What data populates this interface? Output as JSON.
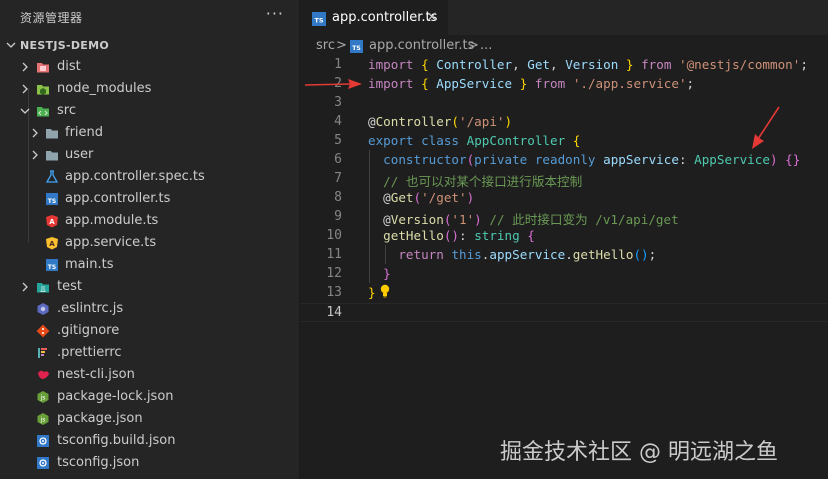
{
  "explorer": {
    "title": "资源管理器",
    "more_label": "···",
    "items": [
      {
        "label": "NESTJS-DEMO",
        "name": "tree-root-nestjs-demo"
      },
      {
        "label": "dist",
        "name": "tree-folder-dist"
      },
      {
        "label": "node_modules",
        "name": "tree-folder-node-modules"
      },
      {
        "label": "src",
        "name": "tree-folder-src"
      },
      {
        "label": "friend",
        "name": "tree-folder-friend"
      },
      {
        "label": "user",
        "name": "tree-folder-user"
      },
      {
        "label": "app.controller.spec.ts",
        "name": "tree-file-app-controller-spec"
      },
      {
        "label": "app.controller.ts",
        "name": "tree-file-app-controller"
      },
      {
        "label": "app.module.ts",
        "name": "tree-file-app-module"
      },
      {
        "label": "app.service.ts",
        "name": "tree-file-app-service"
      },
      {
        "label": "main.ts",
        "name": "tree-file-main"
      },
      {
        "label": "test",
        "name": "tree-folder-test"
      },
      {
        "label": ".eslintrc.js",
        "name": "tree-file-eslintrc"
      },
      {
        "label": ".gitignore",
        "name": "tree-file-gitignore"
      },
      {
        "label": ".prettierrc",
        "name": "tree-file-prettierrc"
      },
      {
        "label": "nest-cli.json",
        "name": "tree-file-nest-cli"
      },
      {
        "label": "package-lock.json",
        "name": "tree-file-package-lock"
      },
      {
        "label": "package.json",
        "name": "tree-file-package"
      },
      {
        "label": "tsconfig.build.json",
        "name": "tree-file-tsconfig-build"
      },
      {
        "label": "tsconfig.json",
        "name": "tree-file-tsconfig"
      }
    ]
  },
  "editor": {
    "tab_label": "app.controller.ts",
    "tab_icon_text": "TS",
    "close_label": "×",
    "breadcrumb": {
      "folder": "src",
      "file": "app.controller.ts",
      "sep": ">",
      "more": "..."
    },
    "line_numbers": [
      "1",
      "2",
      "3",
      "4",
      "5",
      "6",
      "7",
      "8",
      "9",
      "10",
      "11",
      "12",
      "13",
      "14"
    ],
    "lines": [
      [
        [
          "k",
          "import"
        ],
        [
          "p",
          " "
        ],
        [
          "y",
          "{"
        ],
        [
          "v",
          " Controller"
        ],
        [
          "p",
          ","
        ],
        [
          "v",
          " Get"
        ],
        [
          "p",
          ","
        ],
        [
          "v",
          " Version"
        ],
        [
          "p",
          " "
        ],
        [
          "y",
          "}"
        ],
        [
          "p",
          " "
        ],
        [
          "k",
          "from"
        ],
        [
          "p",
          " "
        ],
        [
          "s",
          "'@nestjs/common'"
        ],
        [
          "p",
          ";"
        ]
      ],
      [
        [
          "k",
          "import"
        ],
        [
          "p",
          " "
        ],
        [
          "y",
          "{"
        ],
        [
          "v",
          " AppService"
        ],
        [
          "p",
          " "
        ],
        [
          "y",
          "}"
        ],
        [
          "p",
          " "
        ],
        [
          "k",
          "from"
        ],
        [
          "p",
          " "
        ],
        [
          "s",
          "'./app.service'"
        ],
        [
          "p",
          ";"
        ]
      ],
      [],
      [
        [
          "p",
          "@"
        ],
        [
          "f",
          "Controller"
        ],
        [
          "y",
          "("
        ],
        [
          "s",
          "'/api'"
        ],
        [
          "y",
          ")"
        ]
      ],
      [
        [
          "b",
          "export"
        ],
        [
          "p",
          " "
        ],
        [
          "b",
          "class"
        ],
        [
          "p",
          " "
        ],
        [
          "t",
          "AppController"
        ],
        [
          "p",
          " "
        ],
        [
          "y",
          "{"
        ]
      ],
      [
        [
          "p",
          "  "
        ],
        [
          "b",
          "constructor"
        ],
        [
          "m",
          "("
        ],
        [
          "b",
          "private"
        ],
        [
          "p",
          " "
        ],
        [
          "b",
          "readonly"
        ],
        [
          "p",
          " "
        ],
        [
          "v",
          "appService"
        ],
        [
          "p",
          ": "
        ],
        [
          "t",
          "AppService"
        ],
        [
          "m",
          ")"
        ],
        [
          "p",
          " "
        ],
        [
          "m",
          "{}"
        ]
      ],
      [
        [
          "p",
          "  "
        ],
        [
          "c",
          "// 也可以对某个接口进行版本控制"
        ]
      ],
      [
        [
          "p",
          "  @"
        ],
        [
          "f",
          "Get"
        ],
        [
          "m",
          "("
        ],
        [
          "s",
          "'/get'"
        ],
        [
          "m",
          ")"
        ]
      ],
      [
        [
          "p",
          "  @"
        ],
        [
          "f",
          "Version"
        ],
        [
          "m",
          "("
        ],
        [
          "s",
          "'1'"
        ],
        [
          "m",
          ")"
        ],
        [
          "p",
          " "
        ],
        [
          "c",
          "// 此时接口变为 /v1/api/get"
        ]
      ],
      [
        [
          "p",
          "  "
        ],
        [
          "f",
          "getHello"
        ],
        [
          "m",
          "()"
        ],
        [
          "p",
          ": "
        ],
        [
          "t",
          "string"
        ],
        [
          "p",
          " "
        ],
        [
          "m",
          "{"
        ]
      ],
      [
        [
          "p",
          "    "
        ],
        [
          "k",
          "return"
        ],
        [
          "p",
          " "
        ],
        [
          "b",
          "this"
        ],
        [
          "p",
          "."
        ],
        [
          "v",
          "appService"
        ],
        [
          "p",
          "."
        ],
        [
          "f",
          "getHello"
        ],
        [
          "bl",
          "()"
        ],
        [
          "p",
          ";"
        ]
      ],
      [
        [
          "p",
          "  "
        ],
        [
          "m",
          "}"
        ]
      ],
      [
        [
          "y",
          "}"
        ]
      ],
      []
    ]
  },
  "watermark": "掘金技术社区 @ 明远湖之鱼",
  "colors": {
    "sidebar_bg": "#252526",
    "editor_bg": "#1e1e1e",
    "arrow": "#e53935"
  }
}
